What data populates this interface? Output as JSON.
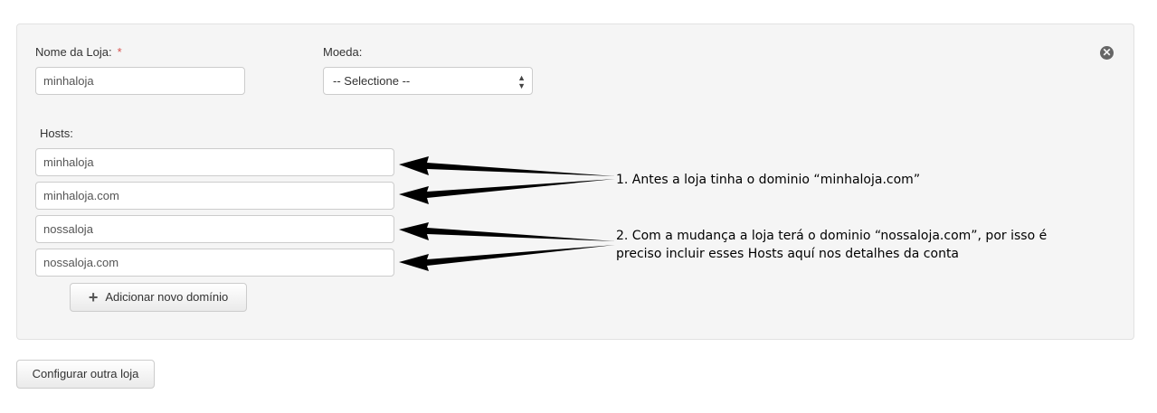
{
  "form": {
    "store_name_label": "Nome da Loja:",
    "required_marker": "*",
    "store_name_value": "minhaloja",
    "currency_label": "Moeda:",
    "currency_selected": "-- Selectione --",
    "hosts_label": "Hosts:",
    "hosts": [
      "minhaloja",
      "minhaloja.com",
      "nossaloja",
      "nossaloja.com"
    ],
    "add_domain_button": "Adicionar novo domínio",
    "close_icon": "close-icon"
  },
  "annotations": {
    "note1": "1. Antes a loja tinha o dominio “minhaloja.com”",
    "note2_line1": "2. Com a mudança a loja terá o dominio “nossaloja.com”, por isso é",
    "note2_line2": "preciso incluir esses Hosts aquí nos detalhes da conta"
  },
  "footer": {
    "configure_button": "Configurar outra loja"
  },
  "colors": {
    "panel_bg": "#f5f5f5",
    "required": "#d9534f",
    "arrow": "#000000"
  }
}
